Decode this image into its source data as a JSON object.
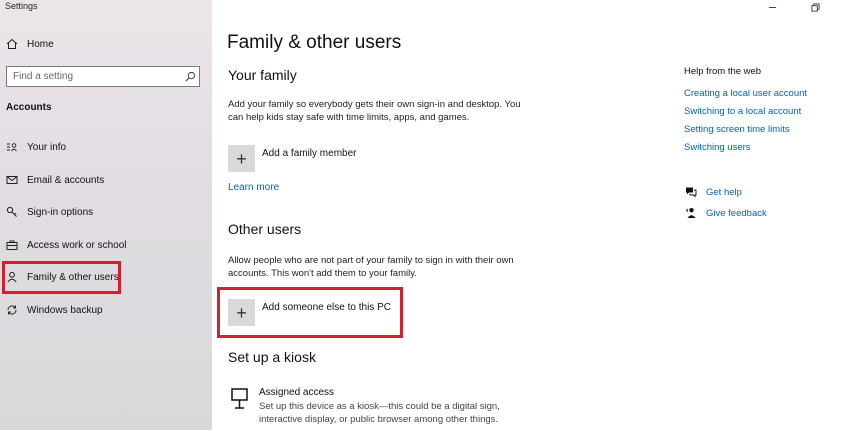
{
  "app": {
    "title": "Settings"
  },
  "sidebar": {
    "home_label": "Home",
    "search_placeholder": "Find a setting",
    "section_label": "Accounts",
    "items": [
      {
        "label": "Your info",
        "icon": "person-card-icon"
      },
      {
        "label": "Email & accounts",
        "icon": "mail-icon"
      },
      {
        "label": "Sign-in options",
        "icon": "key-icon"
      },
      {
        "label": "Access work or school",
        "icon": "briefcase-icon"
      },
      {
        "label": "Family & other users",
        "icon": "person-icon",
        "selected": true
      },
      {
        "label": "Windows backup",
        "icon": "sync-icon"
      }
    ]
  },
  "main": {
    "title": "Family & other users",
    "your_family": {
      "heading": "Your family",
      "description": "Add your family so everybody gets their own sign-in and desktop. You can help kids stay safe with time limits, apps, and games.",
      "add_label": "Add a family member",
      "learn_more": "Learn more"
    },
    "other_users": {
      "heading": "Other users",
      "description": "Allow people who are not part of your family to sign in with their own accounts. This won't add them to your family.",
      "add_label": "Add someone else to this PC"
    },
    "kiosk": {
      "heading": "Set up a kiosk",
      "title": "Assigned access",
      "description": "Set up this device as a kiosk—this could be a digital sign, interactive display, or public browser among other things."
    }
  },
  "help": {
    "title": "Help from the web",
    "links": [
      "Creating a local user account",
      "Switching to a local account",
      "Setting screen time limits",
      "Switching users"
    ],
    "get_help": "Get help",
    "give_feedback": "Give feedback"
  },
  "colors": {
    "accent_link": "#0063b1",
    "highlight": "#d1202f"
  }
}
